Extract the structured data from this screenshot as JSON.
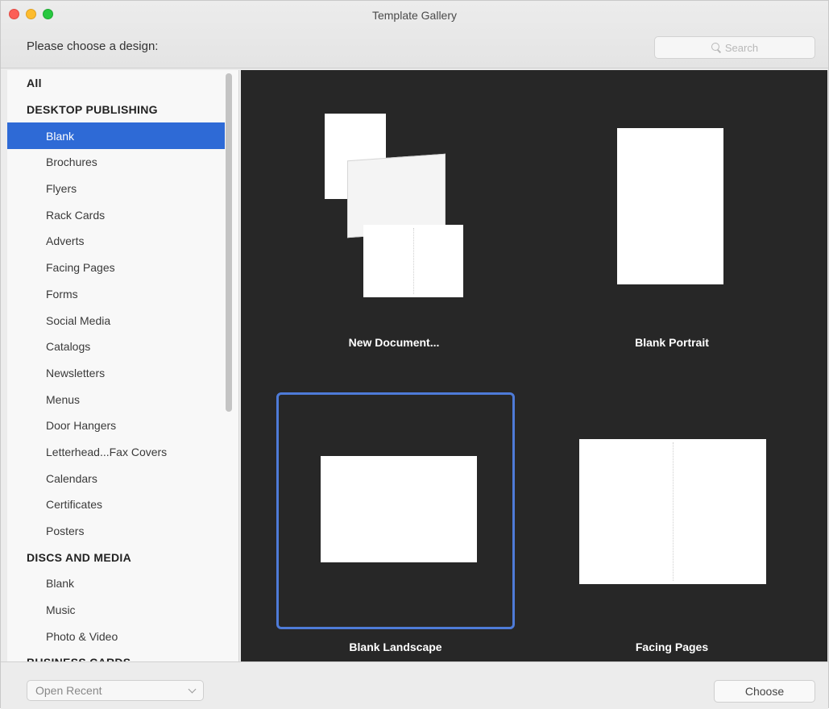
{
  "window": {
    "title": "Template Gallery"
  },
  "header": {
    "prompt": "Please choose a design:"
  },
  "search": {
    "placeholder": "Search"
  },
  "sidebar": {
    "items": [
      {
        "label": "All",
        "type": "header"
      },
      {
        "label": "DESKTOP PUBLISHING",
        "type": "header"
      },
      {
        "label": "Blank",
        "type": "item",
        "selected": true
      },
      {
        "label": "Brochures",
        "type": "item"
      },
      {
        "label": "Flyers",
        "type": "item"
      },
      {
        "label": "Rack Cards",
        "type": "item"
      },
      {
        "label": "Adverts",
        "type": "item"
      },
      {
        "label": "Facing Pages",
        "type": "item"
      },
      {
        "label": "Forms",
        "type": "item"
      },
      {
        "label": "Social Media",
        "type": "item"
      },
      {
        "label": "Catalogs",
        "type": "item"
      },
      {
        "label": "Newsletters",
        "type": "item"
      },
      {
        "label": "Menus",
        "type": "item"
      },
      {
        "label": "Door Hangers",
        "type": "item"
      },
      {
        "label": "Letterhead...Fax Covers",
        "type": "item"
      },
      {
        "label": "Calendars",
        "type": "item"
      },
      {
        "label": "Certificates",
        "type": "item"
      },
      {
        "label": "Posters",
        "type": "item"
      },
      {
        "label": "DISCS AND MEDIA",
        "type": "header"
      },
      {
        "label": "Blank",
        "type": "item"
      },
      {
        "label": "Music",
        "type": "item"
      },
      {
        "label": "Photo & Video",
        "type": "item"
      },
      {
        "label": "BUSINESS CARDS",
        "type": "header"
      }
    ]
  },
  "gallery": {
    "tiles": [
      {
        "label": "New Document..."
      },
      {
        "label": "Blank Portrait"
      },
      {
        "label": "Blank Landscape",
        "selected": true
      },
      {
        "label": "Facing Pages"
      }
    ]
  },
  "footer": {
    "open_recent": "Open Recent",
    "choose": "Choose"
  },
  "colors": {
    "selection": "#2e6ad6",
    "tile_highlight": "#4e7bd8",
    "gallery_bg": "#272727"
  }
}
